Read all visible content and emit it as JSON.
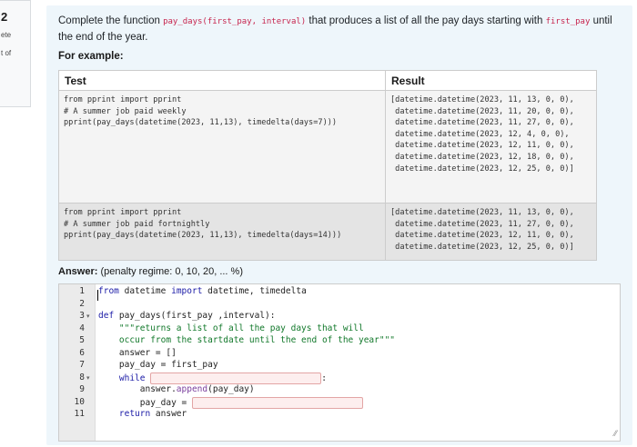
{
  "sidebar": {
    "question_number": "2",
    "state_fragment": "ete",
    "grade_fragment": "t of"
  },
  "question": {
    "text_pre": "Complete the function ",
    "fn_code": "pay_days(first_pay, interval)",
    "text_mid": " that produces a list of all the pay days starting with ",
    "arg_code": "first_pay",
    "text_post": " until the end of the year.",
    "for_example": "For example:"
  },
  "examples": {
    "headers": [
      "Test",
      "Result"
    ],
    "rows": [
      {
        "test": "from pprint import pprint\n# A summer job paid weekly\npprint(pay_days(datetime(2023, 11,13), timedelta(days=7)))",
        "result": "[datetime.datetime(2023, 11, 13, 0, 0),\n datetime.datetime(2023, 11, 20, 0, 0),\n datetime.datetime(2023, 11, 27, 0, 0),\n datetime.datetime(2023, 12, 4, 0, 0),\n datetime.datetime(2023, 12, 11, 0, 0),\n datetime.datetime(2023, 12, 18, 0, 0),\n datetime.datetime(2023, 12, 25, 0, 0)]"
      },
      {
        "test": "from pprint import pprint\n# A summer job paid fortnightly\npprint(pay_days(datetime(2023, 11,13), timedelta(days=14)))",
        "result": "[datetime.datetime(2023, 11, 13, 0, 0),\n datetime.datetime(2023, 11, 27, 0, 0),\n datetime.datetime(2023, 12, 11, 0, 0),\n datetime.datetime(2023, 12, 25, 0, 0)]"
      }
    ]
  },
  "answer": {
    "label": "Answer:",
    "penalty": "(penalty regime: 0, 10, 20, ... %)"
  },
  "editor": {
    "line_numbers": [
      "1",
      "2",
      "3",
      "4",
      "5",
      "6",
      "7",
      "8",
      "9",
      "10",
      "11"
    ],
    "lines": {
      "l1_kw1": "from",
      "l1_mid": " datetime ",
      "l1_kw2": "import",
      "l1_rest": " datetime, timedelta",
      "l3_kw": "def",
      "l3_rest": " pay_days(first_pay ,interval):",
      "l4": "    \"\"\"returns a list of all the pay days that will",
      "l5": "    occur from the startdate until the end of the year\"\"\"",
      "l6": "    answer = []",
      "l7": "    pay_day = first_pay",
      "l8_kw": "    while",
      "l8_colon": ":",
      "l9_pre": "        answer.",
      "l9_fn": "append",
      "l9_post": "(pay_day)",
      "l10": "        pay_day = ",
      "l11_kw": "    return",
      "l11_rest": " answer"
    },
    "blanks": {
      "while_condition": "",
      "pay_day_update": ""
    },
    "fold_markers": [
      "▾",
      "▾"
    ],
    "resize_glyph": "⁄⁄"
  }
}
